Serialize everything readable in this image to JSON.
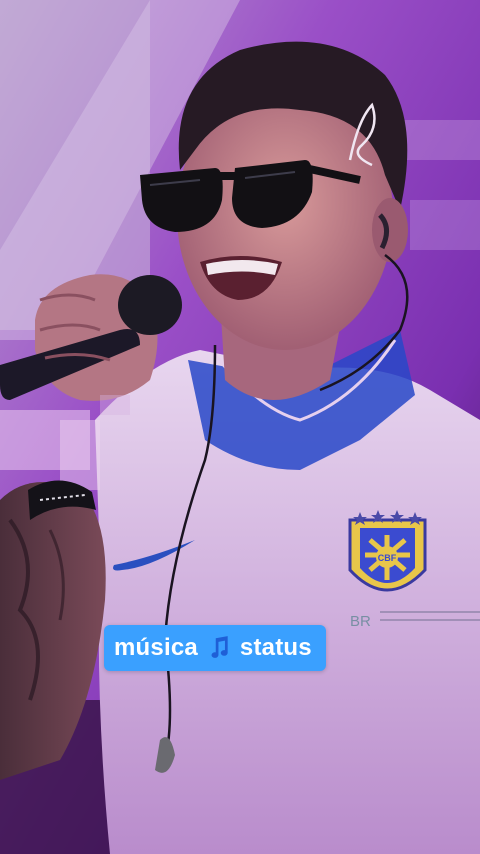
{
  "caption": {
    "word_before": "música",
    "icon": "musical-notes-icon",
    "word_after": "status",
    "background_color": "#3aa0ff",
    "text_color": "#ffffff"
  },
  "photo": {
    "subject": "singer-with-microphone",
    "badge_text": "CBF",
    "shirt_text": "BR"
  }
}
